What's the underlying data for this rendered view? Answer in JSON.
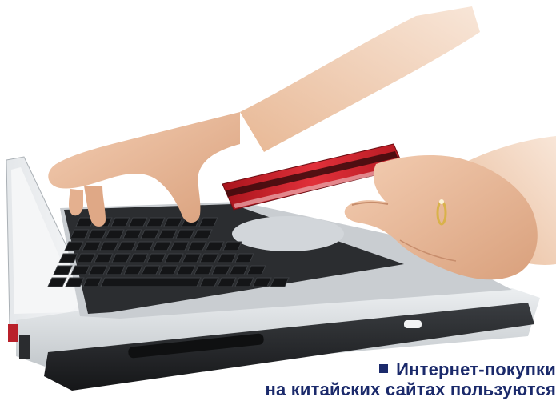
{
  "photo": {
    "subject": "hands-paying-with-credit-card-on-laptop",
    "colors": {
      "background": "#ffffff",
      "skin": "#e9b99a",
      "card_red": "#c8222a",
      "laptop_silver": "#d9dde0",
      "laptop_black": "#202225"
    }
  },
  "caption": {
    "line1": "Интернет-покупки",
    "line2": "на китайских сайтах пользуются",
    "color": "#1b2a6b"
  }
}
